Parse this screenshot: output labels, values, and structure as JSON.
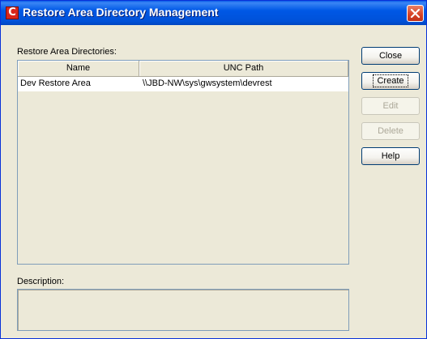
{
  "window": {
    "title": "Restore Area Directory Management",
    "app_icon_glyph": "C"
  },
  "list": {
    "label": "Restore Area Directories:",
    "columns": [
      "Name",
      "UNC Path"
    ],
    "rows": [
      {
        "name": "Dev Restore Area",
        "unc_path": "\\\\JBD-NW\\sys\\gwsystem\\devrest"
      }
    ]
  },
  "description": {
    "label": "Description:",
    "value": ""
  },
  "buttons": {
    "close": "Close",
    "create": "Create",
    "edit": "Edit",
    "delete": "Delete",
    "help": "Help"
  },
  "colors": {
    "titlebar": "#0058e6",
    "window_bg": "#ece9d8",
    "close_button": "#d64125"
  }
}
